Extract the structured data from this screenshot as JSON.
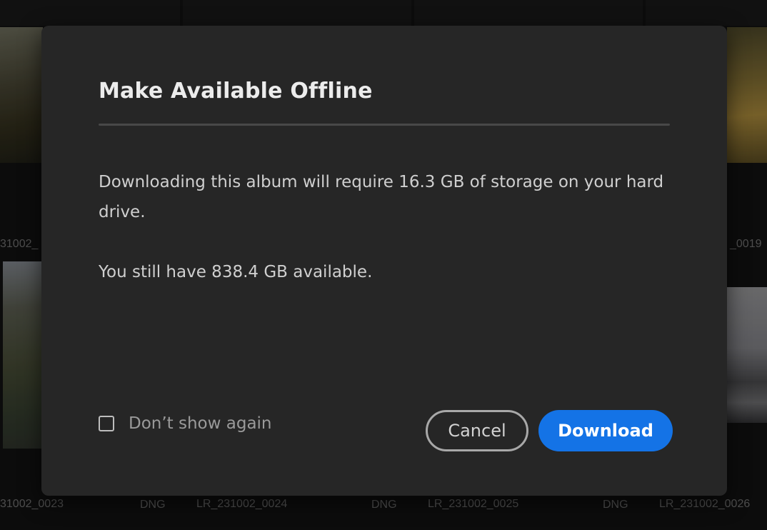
{
  "dialog": {
    "title": "Make Available Offline",
    "message_storage": "Downloading this album will require 16.3 GB of storage on your hard drive.",
    "message_available": "You still have 838.4 GB available.",
    "dont_show_again_label": "Don’t show again",
    "dont_show_again_checked": false,
    "cancel_label": "Cancel",
    "download_label": "Download"
  },
  "background_grid": {
    "row1_labels": [
      "31002_",
      "_0019"
    ],
    "row2_labels": [
      "31002_0023",
      "LR_231002_0024",
      "LR_231002_0025",
      "LR_231002_0026"
    ],
    "row2_types": [
      "DNG",
      "DNG",
      "DNG"
    ]
  },
  "colors": {
    "accent": "#1473e6",
    "dialog_bg": "#262626"
  }
}
